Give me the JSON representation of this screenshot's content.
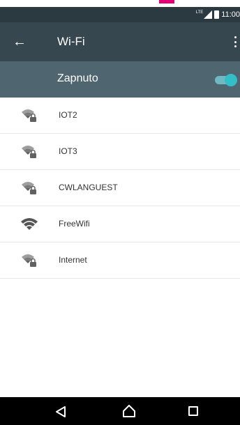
{
  "status_bar": {
    "network": "LTE",
    "time": "11:00"
  },
  "app_bar": {
    "title": "Wi-Fi"
  },
  "wifi_toggle": {
    "label": "Zapnuto",
    "state": "on",
    "accent_color": "#33bec8"
  },
  "networks": [
    {
      "name": "IOT2",
      "secured": true
    },
    {
      "name": "IOT3",
      "secured": true
    },
    {
      "name": "CWLANGUEST",
      "secured": true
    },
    {
      "name": "FreeWifi",
      "secured": false
    },
    {
      "name": "Internet",
      "secured": true
    }
  ],
  "colors": {
    "app_bar": "#37474f",
    "toggle_bar": "#4f6570",
    "brand": "#e20074"
  }
}
